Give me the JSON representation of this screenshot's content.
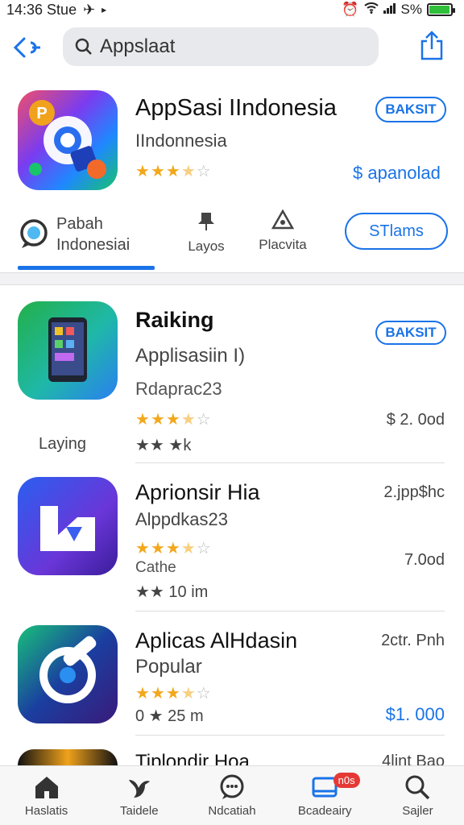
{
  "status_bar": {
    "time": "14:36 Stue",
    "battery": "S%",
    "battery_level": 0.95
  },
  "search": {
    "placeholder": "Appslaat"
  },
  "hero": {
    "title": "AppSasi IIndonesia",
    "subtitle": "IIndonnesia",
    "rating": 3.5,
    "get_label": "BAKSIT",
    "price": "$ apanolad"
  },
  "tabs": {
    "tab1_line1": "Pabah",
    "tab1_line2": "Indonesiai",
    "tab2": "Layos",
    "tab3": "Placvita",
    "streams": "STlams"
  },
  "list": [
    {
      "name": "Raiking",
      "line2": "Applisasiin I)",
      "line3": "Rdaprac23",
      "rating": 3.5,
      "get_label": "BAKSIT",
      "price": "$ 2. 0od",
      "left_caption": "Laying",
      "meta": "★★ ★k"
    },
    {
      "name": "Aprionsir Hia",
      "line2": "Alppdkas23",
      "line3": "Cathe",
      "rating": 3.5,
      "right_top": "2.jpp$hc",
      "price": "7.0od",
      "meta": "★★ 10 im"
    },
    {
      "name": "Aplicas AlHdasin",
      "line2": "Popular",
      "rating": 3.5,
      "right_top": "2ctr. Pnh",
      "price": "$1. 000",
      "meta": "0 ★ 25 m"
    },
    {
      "name": "Tiplondir Hoa",
      "right_top": "4lint Bao"
    }
  ],
  "tabbar": [
    {
      "label": "Haslatis",
      "icon": "home-icon"
    },
    {
      "label": "Taidele",
      "icon": "bird-icon"
    },
    {
      "label": "Ndcatiah",
      "icon": "chat-icon"
    },
    {
      "label": "Bcadeairy",
      "icon": "card-icon",
      "badge": "n0s"
    },
    {
      "label": "Sajler",
      "icon": "search-icon"
    }
  ],
  "colors": {
    "accent": "#1a73e8",
    "star": "#f2a81c",
    "badge": "#e53935"
  }
}
